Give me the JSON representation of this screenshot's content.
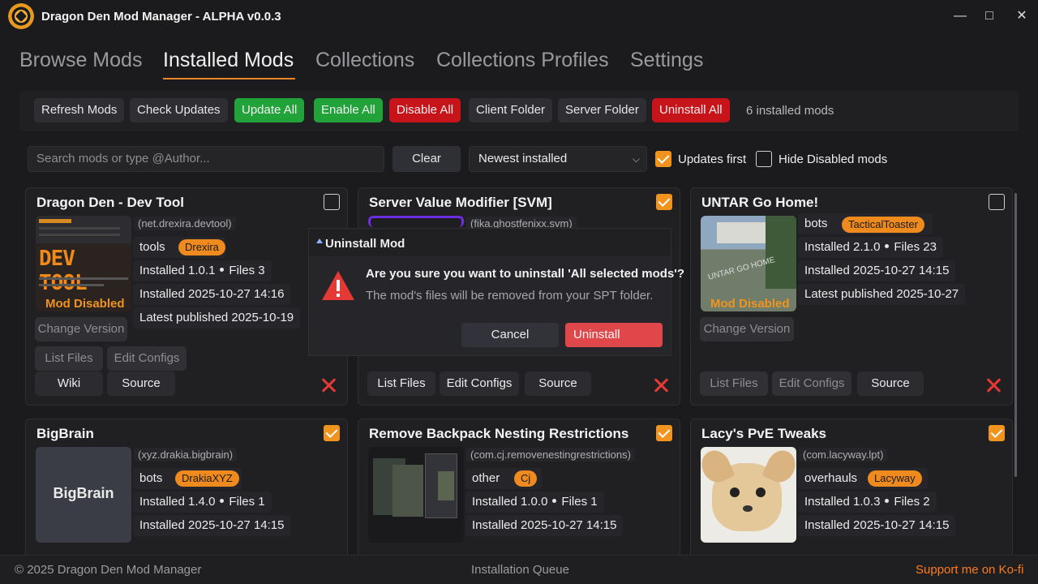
{
  "window": {
    "title": "Dragon Den Mod Manager - ALPHA v0.0.3",
    "minimize_icon": "—",
    "maximize_icon": "□",
    "close_icon": "✕"
  },
  "tabs": [
    {
      "label": "Browse Mods"
    },
    {
      "label": "Installed Mods",
      "active": true
    },
    {
      "label": "Collections"
    },
    {
      "label": "Collections Profiles"
    },
    {
      "label": "Settings"
    }
  ],
  "toolbar": {
    "refresh": "Refresh Mods",
    "check_updates": "Check Updates",
    "update_all": "Update All",
    "enable_all": "Enable All",
    "disable_all": "Disable All",
    "client_folder": "Client Folder",
    "server_folder": "Server Folder",
    "uninstall_all": "Uninstall All",
    "count": "6 installed mods"
  },
  "filters": {
    "search_placeholder": "Search mods or type @Author...",
    "clear": "Clear",
    "sort_value": "Newest installed",
    "updates_first_label": "Updates first",
    "updates_first_checked": true,
    "hide_disabled_label": "Hide Disabled mods",
    "hide_disabled_checked": false
  },
  "mods": [
    {
      "title": "Dragon Den - Dev Tool",
      "id": "(net.drexira.devtool)",
      "category": "tools",
      "author": "Drexira",
      "installed_version": "1.0.1",
      "files": "3",
      "installed_date": "2025-10-27 14:16",
      "latest_published": "2025-10-19",
      "disabled_label": "Mod Disabled",
      "thumb_text": "DEV TOOL",
      "selected": false
    },
    {
      "title": "Server Value Modifier [SVM]",
      "id": "(fika.ghostfenixx.svm)",
      "selected": true
    },
    {
      "title": "UNTAR Go Home!",
      "category": "bots",
      "author": "TacticalToaster",
      "installed_version": "2.1.0",
      "files": "23",
      "installed_date": "2025-10-27 14:15",
      "latest_published": "2025-10-27",
      "disabled_label": "Mod Disabled",
      "thumb_text": "UNTAR GO HOME",
      "selected": false
    },
    {
      "title": "BigBrain",
      "id": "(xyz.drakia.bigbrain)",
      "category": "bots",
      "author": "DrakiaXYZ",
      "installed_version": "1.4.0",
      "files": "1",
      "installed_date": "2025-10-27 14:15",
      "thumb_text": "BigBrain",
      "selected": true
    },
    {
      "title": "Remove Backpack Nesting Restrictions",
      "id": "(com.cj.removenestingrestrictions)",
      "category": "other",
      "author": "Cj",
      "installed_version": "1.0.0",
      "files": "1",
      "installed_date": "2025-10-27 14:15",
      "selected": true
    },
    {
      "title": "Lacy's PvE Tweaks",
      "id": "(com.lacyway.lpt)",
      "category": "overhauls",
      "author": "Lacyway",
      "installed_version": "1.0.3",
      "files": "2",
      "installed_date": "2025-10-27 14:15",
      "selected": true
    }
  ],
  "labels": {
    "installed": "Installed",
    "files": "Files",
    "latest_published": "Latest published",
    "change_version": "Change Version",
    "list_files": "List Files",
    "edit_configs": "Edit Configs",
    "wiki": "Wiki",
    "source": "Source"
  },
  "dialog": {
    "title": "Uninstall Mod",
    "question": "Are you sure you want to uninstall 'All selected mods'?",
    "subtext": "The mod's files will be removed from your SPT folder.",
    "cancel": "Cancel",
    "confirm": "Uninstall"
  },
  "footer": {
    "copyright": "© 2025 Dragon Den Mod Manager",
    "queue": "Installation Queue",
    "support": "Support me on Ko-fi"
  },
  "colors": {
    "accent": "#f0941e",
    "danger": "#e53935",
    "success": "#22a33a",
    "background": "#1b1b1d"
  }
}
